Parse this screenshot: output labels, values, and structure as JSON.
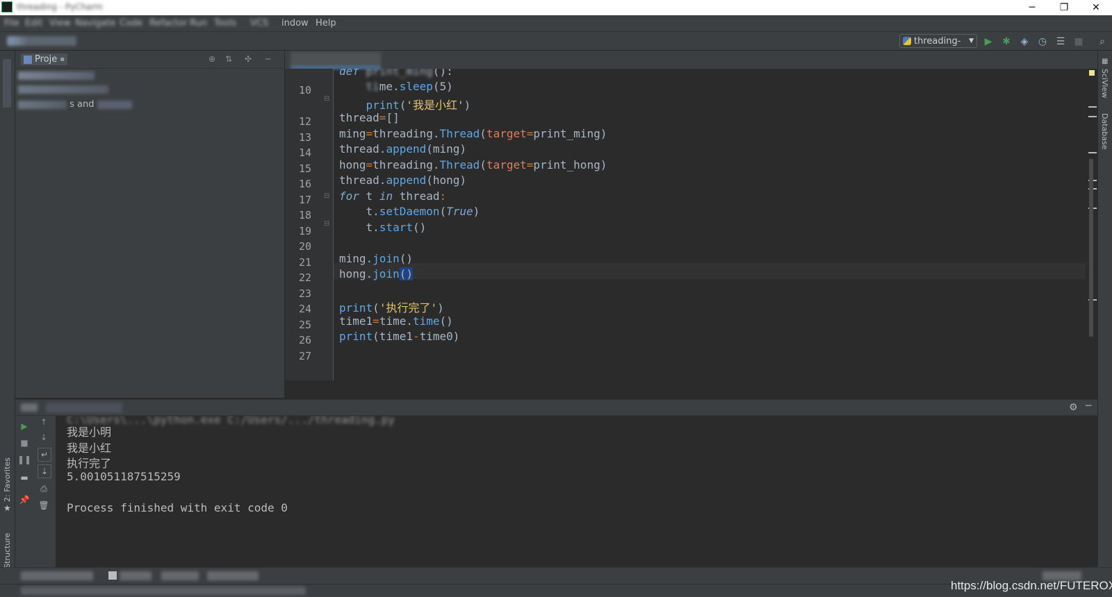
{
  "window": {
    "title": "threading - PyCharm",
    "controls": {
      "minimize": "─",
      "maximize": "❐",
      "close": "✕"
    }
  },
  "menu": {
    "items": [
      "File",
      "Edit",
      "View",
      "Navigate",
      "Code",
      "Refactor",
      "Run",
      "Tools",
      "VCS",
      "Window",
      "Help"
    ],
    "visible_window": "indow",
    "visible_help": "Help"
  },
  "toolbar": {
    "run_config": "threading-",
    "icons": [
      "run-icon",
      "debug-icon",
      "coverage-icon",
      "profile-icon",
      "concurrency-icon",
      "stop-icon",
      "search-icon"
    ]
  },
  "project_panel": {
    "tab_label": "Proje",
    "tree": [
      "threading  pyc",
      "External Libraries",
      "Scratches and Consoles"
    ],
    "tree_visible": [
      "",
      "l",
      "s and"
    ]
  },
  "editor": {
    "file_tab": "threading.py",
    "current_line": 22,
    "line_numbers": [
      "",
      "10",
      "",
      "12",
      "13",
      "14",
      "15",
      "16",
      "17",
      "18",
      "19",
      "20",
      "21",
      "22",
      "23",
      "24",
      "25",
      "26",
      "27"
    ]
  },
  "right_strip": {
    "sciview": "SciView",
    "database": "Database"
  },
  "left_strip": {
    "favorites": "2: Favorites",
    "structure": "7: Structure"
  },
  "run_panel": {
    "tab_label": "Run:",
    "config_tab": "threading",
    "output": {
      "command": "C:\\Users\\...\\python.exe C:/Users/.../threading.py",
      "line1": "我是小明",
      "line2": "我是小红",
      "line3": "执行完了",
      "line4": "5.001051187515259",
      "line5": "",
      "line6": "Process finished with exit code 0"
    }
  },
  "bottom_tools": [
    "6: TODO",
    "Terminal",
    "Python Console",
    "4: Run"
  ],
  "status": {
    "message": "",
    "watermark": "https://blog.csdn.net/FUTEROX"
  },
  "colors": {
    "bg_editor": "#2b2b2b",
    "bg_panel": "#3c3f41",
    "keyword_blue": "#5fa8e8",
    "string_yellow": "#e0c56b",
    "operator_orange": "#cc7832",
    "run_green": "#499c54"
  }
}
